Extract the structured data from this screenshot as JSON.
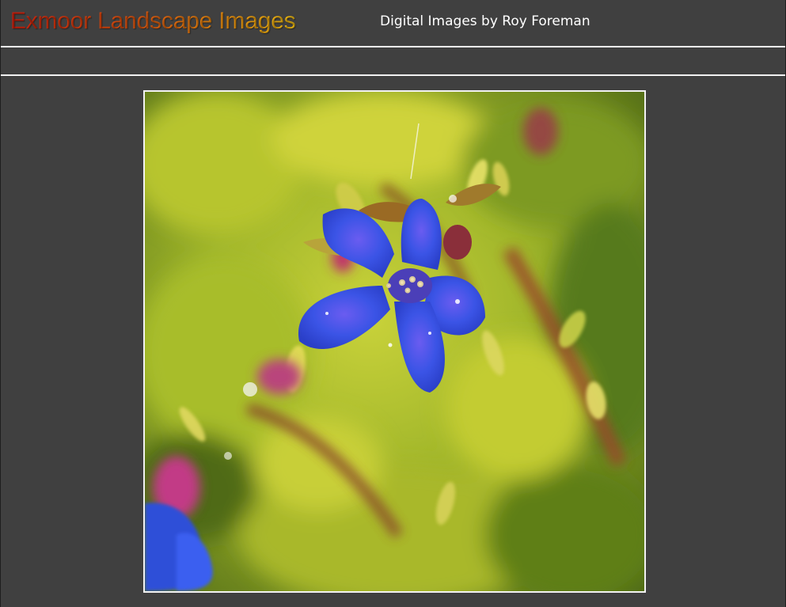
{
  "header": {
    "title": "Exmoor Landscape Images",
    "subtitle": "Digital Images by Roy Foreman"
  },
  "photo": {
    "subject": "blue-flower-photo"
  },
  "colors": {
    "background": "#404040",
    "divider": "#f2f2f2",
    "title_gradient_start": "#d11f0c",
    "title_gradient_end": "#f7c213",
    "subtitle": "#ffffff"
  }
}
